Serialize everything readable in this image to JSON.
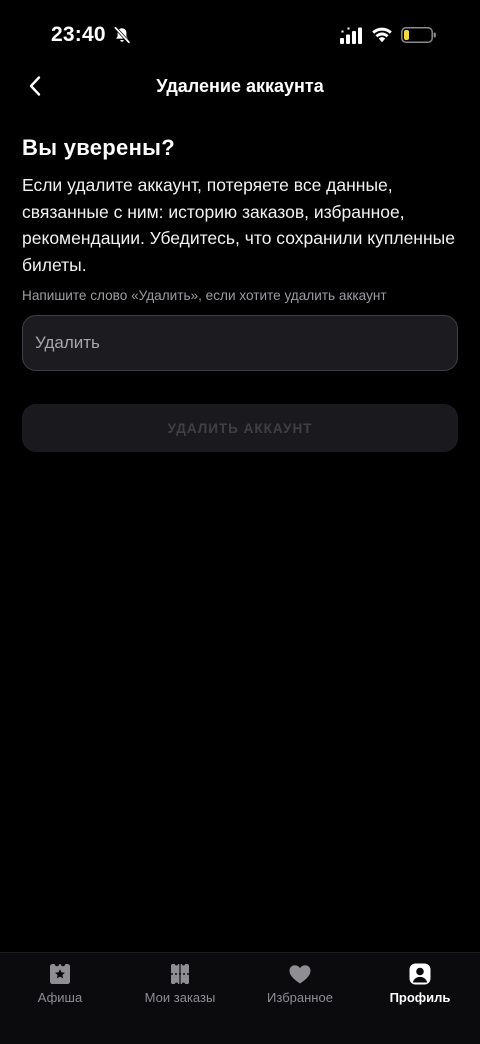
{
  "status_bar": {
    "time": "23:40"
  },
  "header": {
    "title": "Удаление аккаунта"
  },
  "content": {
    "heading": "Вы уверены?",
    "description": "Если удалите аккаунт, потеряете все данные, связанные с ним: историю заказов, избранное, рекомендации. Убедитесь, что сохранили купленные билеты.",
    "hint": "Напишите слово «Удалить», если хотите удалить аккаунт",
    "input": {
      "value": "",
      "placeholder": "Удалить"
    },
    "delete_button_label": "УДАЛИТЬ АККАУНТ"
  },
  "tab_bar": {
    "tabs": [
      {
        "label": "Афиша",
        "icon": "ticket-star-icon",
        "active": false
      },
      {
        "label": "Мои заказы",
        "icon": "tickets-icon",
        "active": false
      },
      {
        "label": "Избранное",
        "icon": "heart-icon",
        "active": false
      },
      {
        "label": "Профиль",
        "icon": "profile-icon",
        "active": true
      }
    ]
  },
  "colors": {
    "background": "#000000",
    "input_background": "#1c1c20",
    "input_border": "#3e3e45",
    "button_disabled_background": "#1a1a1e",
    "button_disabled_text": "#3f3f45",
    "tab_inactive": "#8e8e93",
    "tab_active": "#ffffff",
    "battery_low": "#f4d93b"
  }
}
